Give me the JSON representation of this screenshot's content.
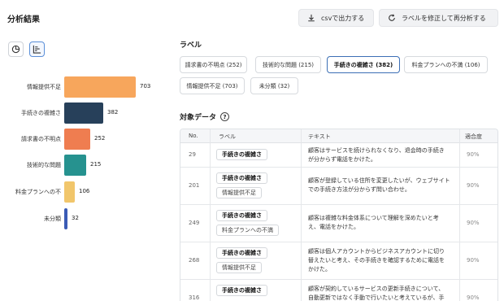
{
  "header": {
    "title": "分析結果",
    "export_label": "csvで出力する",
    "reanalyze_label": "ラベルを修正して再分析する"
  },
  "chart_data": {
    "type": "bar",
    "orientation": "horizontal",
    "categories": [
      "情報提供不足",
      "手続きの複雑さ",
      "請求書の不明点",
      "技術的な問題",
      "料金プランへの不",
      "未分類"
    ],
    "values": [
      703,
      382,
      252,
      215,
      106,
      32
    ],
    "colors": [
      "#f7a65c",
      "#27405a",
      "#ef7d50",
      "#26928f",
      "#f1c66b",
      "#3a5bb5"
    ],
    "title": "",
    "xlabel": "",
    "ylabel": "",
    "xlim": [
      0,
      703
    ],
    "grid": false
  },
  "labels": {
    "title": "ラベル",
    "chips": [
      {
        "text": "請求書の不明点 (252)",
        "active": false
      },
      {
        "text": "技術的な問題 (215)",
        "active": false
      },
      {
        "text": "手続きの複雑さ (382)",
        "active": true
      },
      {
        "text": "料金プランへの不満 (106)",
        "active": false
      },
      {
        "text": "情報提供不足 (703)",
        "active": false
      },
      {
        "text": "未分類 (32)",
        "active": false
      }
    ]
  },
  "target": {
    "title": "対象データ",
    "help_symbol": "?"
  },
  "table": {
    "headers": [
      "No.",
      "ラベル",
      "テキスト",
      "適合度"
    ],
    "rows": [
      {
        "no": "29",
        "labels": [
          "手続きの複雑さ"
        ],
        "text": [
          "顧客はサービスを続けられなくなり、退会時の手続き",
          "が分からず電話をかけた。"
        ],
        "fit": "90%"
      },
      {
        "no": "201",
        "labels": [
          "手続きの複雑さ",
          "情報提供不足"
        ],
        "text": [
          "顧客が登録している住所を変更したいが、ウェブサイト",
          "での手続き方法が分からず問い合わせ。"
        ],
        "fit": "90%"
      },
      {
        "no": "249",
        "labels": [
          "手続きの複雑さ",
          "料金プランへの不満"
        ],
        "text": [
          "顧客は複雑な料金体系について理解を深めたいと考",
          "え、電話をかけた。"
        ],
        "fit": "90%"
      },
      {
        "no": "268",
        "labels": [
          "手続きの複雑さ",
          "情報提供不足"
        ],
        "text": [
          "顧客は個人アカウントからビジネスアカウントに切り",
          "替えたいと考え、その手続きを確認するために電話を",
          "かけた。"
        ],
        "fit": "90%"
      },
      {
        "no": "316",
        "labels": [
          "手続きの複雑さ"
        ],
        "text": [
          "顧客が契約しているサービスの更新手続きについて、",
          "自動更新ではなく手動で行いたいと考えているが、手"
        ],
        "fit": "90%"
      }
    ]
  }
}
